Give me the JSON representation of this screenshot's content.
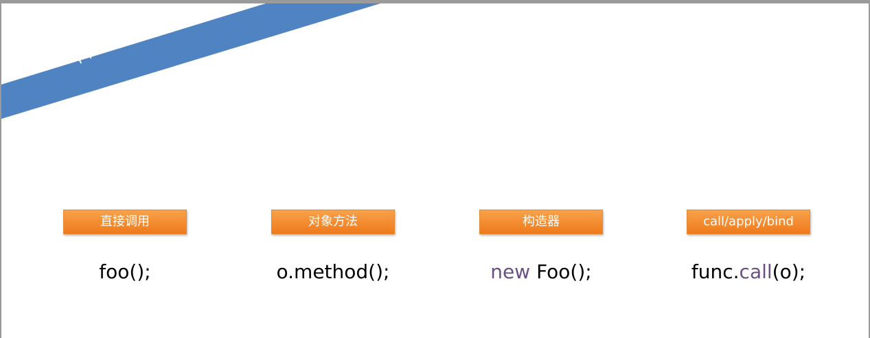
{
  "slide": {
    "title": "不同的调用方式",
    "banner_color": "#4f83c1"
  },
  "columns": [
    {
      "label": "直接调用",
      "code": {
        "text": "foo();"
      }
    },
    {
      "label": "对象方法",
      "code": {
        "text": "o.method();"
      }
    },
    {
      "label": "构造器",
      "code": {
        "keyword": "new",
        "rest": "Foo();"
      }
    },
    {
      "label": "call/apply/bind",
      "code": {
        "prefix": "func.",
        "keyword": "call",
        "suffix": "(o);"
      }
    }
  ],
  "colors": {
    "label_box": "#f28c2f",
    "keyword": "#6a4f85"
  }
}
